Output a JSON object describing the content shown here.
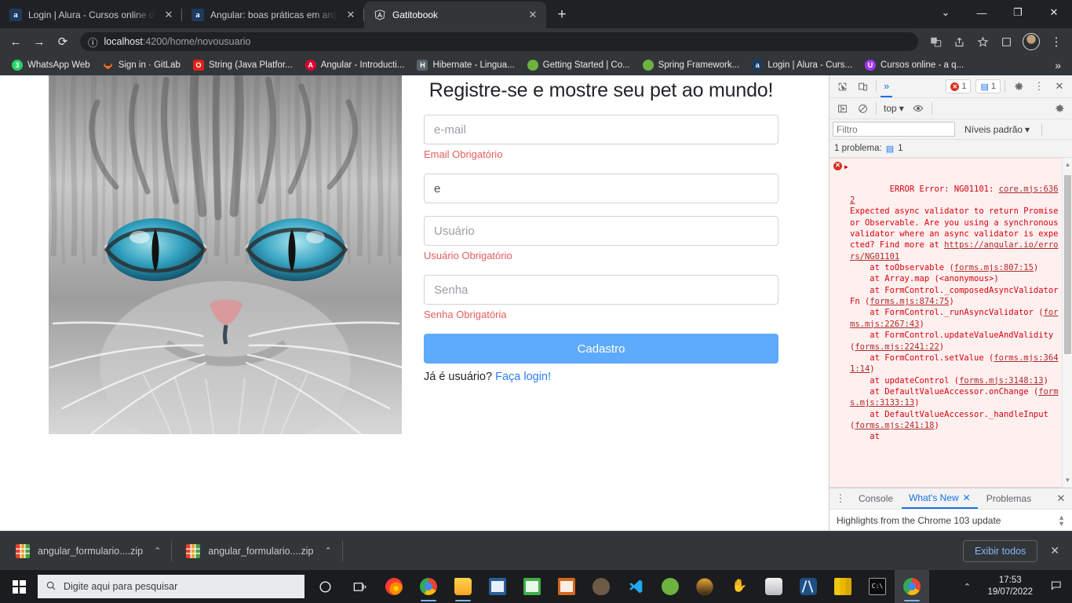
{
  "browser": {
    "tabs": [
      {
        "title": "Login | Alura - Cursos online de t",
        "favicon": "alura-icon",
        "active": false
      },
      {
        "title": "Angular: boas práticas em arquite",
        "favicon": "alura-icon",
        "active": false
      },
      {
        "title": "Gatitobook",
        "favicon": "angular-icon",
        "active": true
      }
    ],
    "new_tab_label": "+",
    "window_controls": {
      "minimize_group": "⌄",
      "minimize": "—",
      "maximize": "❐",
      "close": "✕"
    },
    "nav": {
      "back": "←",
      "forward": "→",
      "reload": "⟳"
    },
    "omnibox": {
      "info_icon": "ⓘ",
      "url_host": "localhost",
      "url_path": ":4200/home/novousuario"
    },
    "toolbar_right": {
      "translate": "translate-icon",
      "share": "share-icon",
      "bookmark": "star-icon",
      "sidepanel": "side-panel-icon",
      "profile": "avatar",
      "menu": "⋮"
    },
    "bookmarks": [
      {
        "label": "WhatsApp Web",
        "icon_letter": "3",
        "icon_color": "#25D366"
      },
      {
        "label": "Sign in · GitLab",
        "icon_letter": "",
        "icon_color": "#FC6D26"
      },
      {
        "label": "String (Java Platfor...",
        "icon_letter": "O",
        "icon_color": "#E32119"
      },
      {
        "label": "Angular - Introducti...",
        "icon_letter": "A",
        "icon_color": "#DD0031"
      },
      {
        "label": "Hibernate - Lingua...",
        "icon_letter": "H",
        "icon_color": "#59666C"
      },
      {
        "label": "Getting Started | Co...",
        "icon_letter": "",
        "icon_color": "#6DB33F"
      },
      {
        "label": "Spring Framework...",
        "icon_letter": "",
        "icon_color": "#6DB33F"
      },
      {
        "label": "Login | Alura - Curs...",
        "icon_letter": "a",
        "icon_color": "#1E3A5F"
      },
      {
        "label": "Cursos online - a q...",
        "icon_letter": "U",
        "icon_color": "#A435F0"
      }
    ],
    "bookmarks_overflow": "»"
  },
  "page": {
    "hero_image_alt": "cat-photo",
    "title": "Registre-se e mostre seu pet ao mundo!",
    "fields": [
      {
        "name": "email",
        "placeholder": "e-mail",
        "value": "",
        "error": "Email Obrigatório"
      },
      {
        "name": "full-name",
        "placeholder": "",
        "value": "e",
        "error": ""
      },
      {
        "name": "user",
        "placeholder": "Usuário",
        "value": "",
        "error": "Usuário Obrigatório"
      },
      {
        "name": "password",
        "placeholder": "Senha",
        "value": "",
        "error": "Senha Obrigatória"
      }
    ],
    "submit_label": "Cadastro",
    "login_prompt": "Já é usuário? ",
    "login_link": "Faça login!"
  },
  "devtools": {
    "toolbar": {
      "inspect_icon": "inspect-element-icon",
      "device_icon": "device-toolbar-icon",
      "more_tabs": "»",
      "error_count": "1",
      "message_count": "1",
      "settings_icon": "gear-icon",
      "kebab_icon": "⋮",
      "close_icon": "✕"
    },
    "console_bar": {
      "sidebar_icon": "console-sidebar-icon",
      "clear_icon": "clear-console-icon",
      "context": "top",
      "eye_icon": "live-expression-icon",
      "settings_icon": "gear-icon"
    },
    "filter_placeholder": "Filtro",
    "levels_label": "Níveis padrão",
    "issues_label": "1 problema:",
    "issues_count": "1",
    "console_message": {
      "level": "error",
      "header": "ERROR Error: NG01101:",
      "source_link": "core.mjs:6362",
      "body_part1": "Expected async validator to return Promise or Observable. Are you using a synchronous validator where an async validator is expected? Find more at ",
      "body_link": "https://angular.io/errors/NG01101",
      "stack": [
        {
          "text": "    at toObservable (",
          "link": "forms.mjs:807:15",
          "tail": ")"
        },
        {
          "text": "    at Array.map (<anonymous>)",
          "link": "",
          "tail": ""
        },
        {
          "text": "    at FormControl._composedAsyncValidatorFn (",
          "link": "forms.mjs:874:75",
          "tail": ")"
        },
        {
          "text": "    at FormControl._runAsyncValidator (",
          "link": "forms.mjs:2267:43",
          "tail": ")"
        },
        {
          "text": "    at FormControl.updateValueAndValidity (",
          "link": "forms.mjs:2241:22",
          "tail": ")"
        },
        {
          "text": "    at FormControl.setValue (",
          "link": "forms.mjs:3641:14",
          "tail": ")"
        },
        {
          "text": "    at updateControl (",
          "link": "forms.mjs:3148:13",
          "tail": ")"
        },
        {
          "text": "    at DefaultValueAccessor.onChange (",
          "link": "forms.mjs:3133:13",
          "tail": ")"
        },
        {
          "text": "    at DefaultValueAccessor._handleInput (",
          "link": "forms.mjs:241:18",
          "tail": ")"
        },
        {
          "text": "    at",
          "link": "",
          "tail": ""
        }
      ]
    },
    "drawer": {
      "kebab": "⋮",
      "tabs": [
        {
          "label": "Console",
          "selected": false,
          "closable": false
        },
        {
          "label": "What's New",
          "selected": true,
          "closable": true
        },
        {
          "label": "Problemas",
          "selected": false,
          "closable": false
        }
      ],
      "close_icon": "✕",
      "content": "Highlights from the Chrome 103 update"
    }
  },
  "downloads": {
    "items": [
      {
        "filename": "angular_formulario....zip",
        "caret": "⌃"
      },
      {
        "filename": "angular_formulario....zip",
        "caret": "⌃"
      }
    ],
    "show_all_label": "Exibir todos",
    "close_icon": "✕"
  },
  "taskbar": {
    "start_icon": "windows-start-icon",
    "search_placeholder": "Digite aqui para pesquisar",
    "search_icon": "search-icon",
    "pinned": [
      {
        "name": "cortana-icon",
        "color": "#ffffff"
      },
      {
        "name": "task-view-icon",
        "color": "#ffffff"
      },
      {
        "name": "firefox-icon",
        "color": "#ff7139"
      },
      {
        "name": "chrome-icon",
        "color": "#4285f4"
      },
      {
        "name": "file-explorer-icon",
        "color": "#ffb900"
      },
      {
        "name": "libreoffice-writer-icon",
        "color": "#2a6099"
      },
      {
        "name": "libreoffice-calc-icon",
        "color": "#3faf46"
      },
      {
        "name": "libreoffice-impress-icon",
        "color": "#d2691e"
      },
      {
        "name": "gimp-icon",
        "color": "#5c4a38"
      },
      {
        "name": "vscode-icon",
        "color": "#22a7f0"
      },
      {
        "name": "spring-tools-icon",
        "color": "#6db33f"
      },
      {
        "name": "dbeaver-icon",
        "color": "#d9a441"
      },
      {
        "name": "postman-icon",
        "color": "#ff6c37"
      },
      {
        "name": "insomnia-icon",
        "color": "#9aa0a6"
      },
      {
        "name": "mongodb-compass-icon",
        "color": "#1f4f82"
      },
      {
        "name": "powerbi-icon",
        "color": "#f2c811"
      },
      {
        "name": "terminal-icon",
        "color": "#0c0c0c"
      },
      {
        "name": "chrome-active-icon",
        "color": "#4285f4"
      }
    ],
    "tray_caret": "⌃",
    "time": "17:53",
    "date": "19/07/2022",
    "notification_icon": "notification-icon"
  }
}
